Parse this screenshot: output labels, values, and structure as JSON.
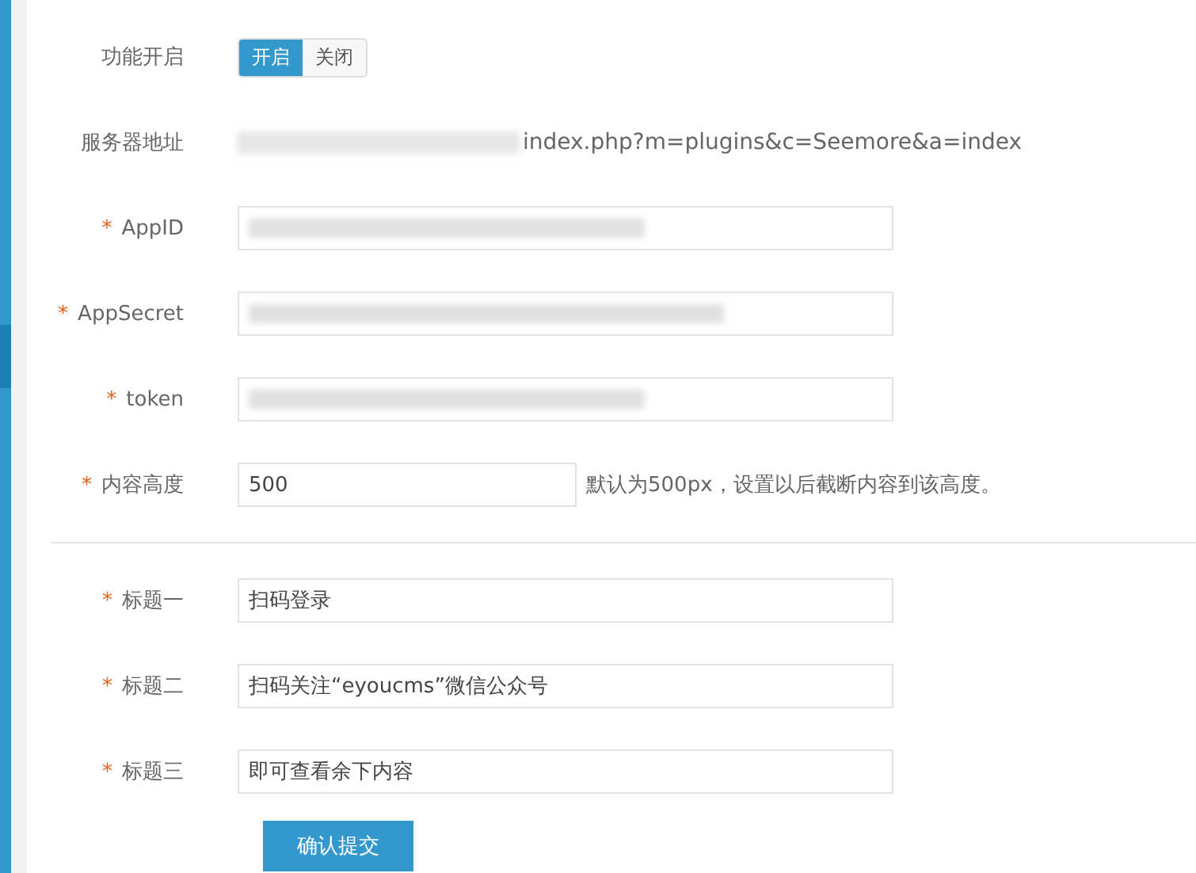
{
  "toggle": {
    "label": "功能开启",
    "options": [
      {
        "label": "开启",
        "selected": true
      },
      {
        "label": "关闭",
        "selected": false
      }
    ]
  },
  "server": {
    "label": "服务器地址",
    "value": "index.php?m=plugins&c=Seemore&a=index"
  },
  "fields": [
    {
      "label": "AppID",
      "required": true,
      "kind": "redacted"
    },
    {
      "label": "AppSecret",
      "required": true,
      "kind": "redacted"
    },
    {
      "label": "token",
      "required": true,
      "kind": "redacted"
    },
    {
      "label": "内容高度",
      "required": true,
      "kind": "text",
      "value": "500",
      "hint": "默认为500px，设置以后截断内容到该高度。"
    }
  ],
  "title_fields": [
    {
      "label": "标题一",
      "required": true,
      "kind": "text",
      "value": "扫码登录"
    },
    {
      "label": "标题二",
      "required": true,
      "kind": "text",
      "value": "扫码关注“eyoucms”微信公众号"
    },
    {
      "label": "标题三",
      "required": true,
      "kind": "text",
      "value": "即可查看余下内容"
    }
  ],
  "submit": "确认提交",
  "required_mark": "*"
}
